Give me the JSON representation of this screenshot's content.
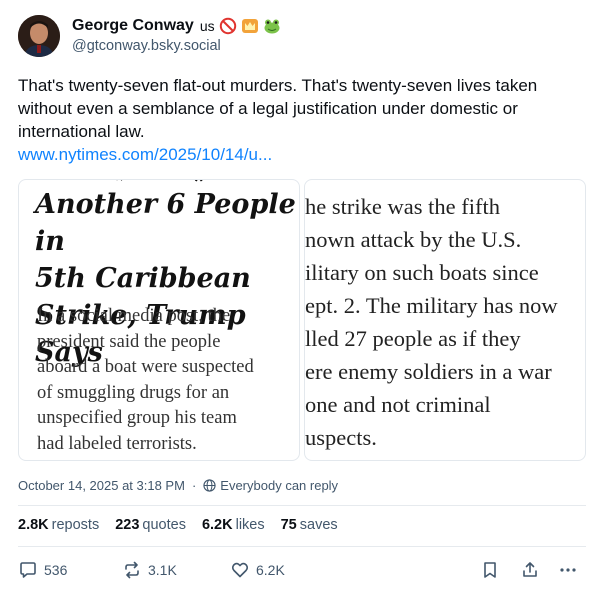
{
  "author": {
    "display_name": "George Conway",
    "name_suffix": "us",
    "handle": "@gtconway.bsky.social",
    "badges": [
      "no-entry-icon",
      "crown-icon",
      "frog-icon"
    ]
  },
  "post": {
    "text": "That's twenty-seven flat-out murders.  That's twenty-seven lives taken without even a semblance of a legal justification under domestic or international law.",
    "link": "www.nytimes.com/2025/10/14/u..."
  },
  "images": {
    "left": {
      "headline": "Another 6 People in\n5th Caribbean\nStrike, Trump Says",
      "dek": "In a social media post, the\npresident said the people\naboard a boat were suspected\nof smuggling drugs for an\nunspecified group his team\nhad labeled terrorists."
    },
    "right": {
      "body": "he strike was the fifth\nnown attack by the U.S.\nilitary on such boats since\nept. 2. The military has now\nlled 27 people as if they\nere enemy soldiers in a war\none and not criminal\nuspects."
    }
  },
  "meta": {
    "timestamp": "October 14, 2025 at 3:18 PM",
    "separator": "·",
    "reply_setting": "Everybody can reply"
  },
  "stats": [
    {
      "count": "2.8K",
      "label": "reposts"
    },
    {
      "count": "223",
      "label": "quotes"
    },
    {
      "count": "6.2K",
      "label": "likes"
    },
    {
      "count": "75",
      "label": "saves"
    }
  ],
  "actions": {
    "reply_count": "536",
    "repost_count": "3.1K",
    "like_count": "6.2K"
  },
  "colors": {
    "link": "#1083fe",
    "muted": "#42576c",
    "text": "#0b0f14",
    "border": "#e6eaee"
  }
}
